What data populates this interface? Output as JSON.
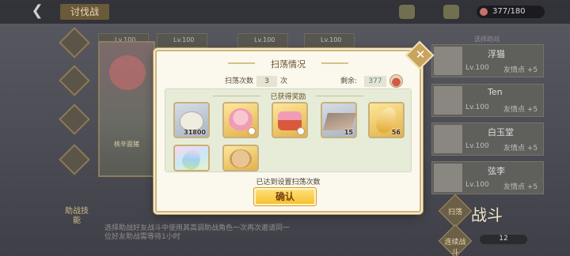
{
  "header": {
    "back_icon": "back-arrow-icon",
    "title": "讨伐战",
    "stamina": "377/180"
  },
  "sidebar": {
    "strategy_label": "助战技能"
  },
  "cards": {
    "level_labels": [
      "Lv.100",
      "Lv.100",
      "Lv.100",
      "Lv.100"
    ],
    "character_name": "桃辛面猪"
  },
  "description": "选择助战好友战斗中使用其高调助战角色一次再次邀请同一位好友助战需等待1小时",
  "friends": {
    "header": "选择助战",
    "list": [
      {
        "name": "浮猫",
        "level": "Lv.100",
        "friendship": "友情点 +5"
      },
      {
        "name": "Ten",
        "level": "Lv.100",
        "friendship": "友情点 +5"
      },
      {
        "name": "白玉堂",
        "level": "Lv.100",
        "friendship": "友情点 +5"
      },
      {
        "name": "弦李",
        "level": "Lv.100",
        "friendship": "友情点 +5"
      }
    ]
  },
  "bottom": {
    "sweep_label": "扫荡",
    "continuous_label": "连续战斗",
    "battle_label": "战斗",
    "battle_cost": "12"
  },
  "dialog": {
    "title": "扫荡情况",
    "sweep_count_label": "扫荡次数",
    "sweep_count": "3",
    "sweep_count_unit": "次",
    "remaining_label": "剩余:",
    "remaining_value": "377",
    "rewards_title": "已获得奖励",
    "rewards": [
      {
        "icon": "dumpling-icon",
        "style": "bluegray",
        "qty": "31800"
      },
      {
        "icon": "pink-character-icon",
        "style": "gold",
        "qty": ""
      },
      {
        "icon": "cake-icon",
        "style": "gold",
        "qty": ""
      },
      {
        "icon": "tray-icon",
        "style": "bluegray",
        "qty": "15"
      },
      {
        "icon": "golden-leaf-icon",
        "style": "gold",
        "qty": "56"
      },
      {
        "icon": "rainbow-leaf-icon",
        "style": "rainbow",
        "qty": ""
      },
      {
        "icon": "cookie-icon",
        "style": "gold",
        "qty": ""
      }
    ],
    "done_text": "已达到设置扫荡次数",
    "confirm_label": "确认"
  },
  "colors": {
    "dialog_bg": "#fbf8ed",
    "rewards_bg": "#e7ecd9",
    "confirm_bg": "#f5bf2a",
    "remaining_text": "#4d8f8a"
  }
}
